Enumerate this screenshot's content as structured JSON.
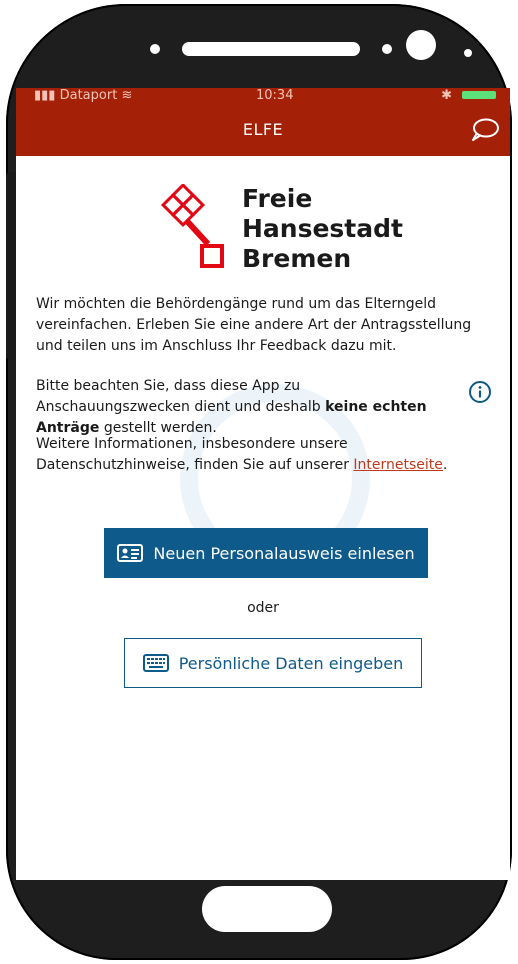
{
  "status_bar": {
    "carrier": "Dataport",
    "time": "10:34"
  },
  "app_bar": {
    "title": "ELFE",
    "feedback_icon": "speech-bubble-icon"
  },
  "logo": {
    "line1": "Freie",
    "line2": "Hansestadt",
    "line3": "Bremen"
  },
  "intro": {
    "paragraph1": "Wir möchten die Behördengänge rund um das Elterngeld vereinfachen. Erleben Sie eine andere Art der Antragsstellung und teilen uns im Anschluss Ihr Feedback dazu mit.",
    "paragraph2_before": "Bitte beachten Sie, dass diese App zu Anschauungszwecken dient und deshalb ",
    "paragraph2_bold": "keine echten Anträge",
    "paragraph2_after": " gestellt werden.",
    "paragraph3_before": "Weitere Informationen, insbesondere unsere Datenschutzhinweise, finden Sie auf unserer ",
    "paragraph3_link": "Internetseite",
    "paragraph3_after": "."
  },
  "actions": {
    "primary_label": "Neuen Personalausweis einlesen",
    "primary_icon": "id-card-icon",
    "separator": "oder",
    "secondary_label": "Persönliche Daten eingeben",
    "secondary_icon": "keyboard-icon"
  },
  "colors": {
    "app_bar": "#a42108",
    "primary_button": "#0e5a8a",
    "link": "#c0391b",
    "logo_red": "#e30613"
  }
}
